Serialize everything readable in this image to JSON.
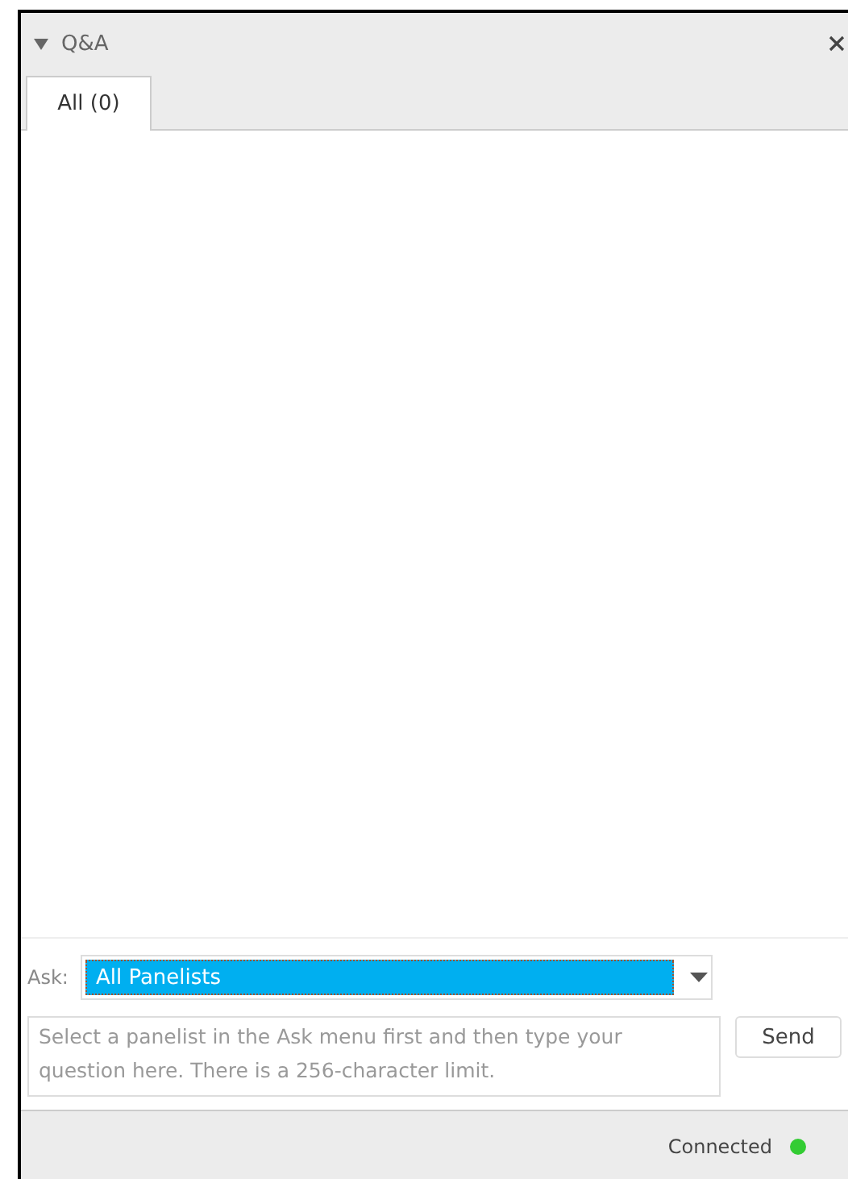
{
  "panel": {
    "title": "Q&A",
    "expanded": true
  },
  "tabs": [
    {
      "label": "All (0)",
      "selected": true
    }
  ],
  "ask": {
    "label": "Ask:",
    "value": "All Panelists"
  },
  "question": {
    "placeholder": "Select a panelist in the Ask menu first and then type your question here. There is a 256-character limit."
  },
  "send_button": "Send",
  "status_bar": {
    "text": "Connected"
  }
}
